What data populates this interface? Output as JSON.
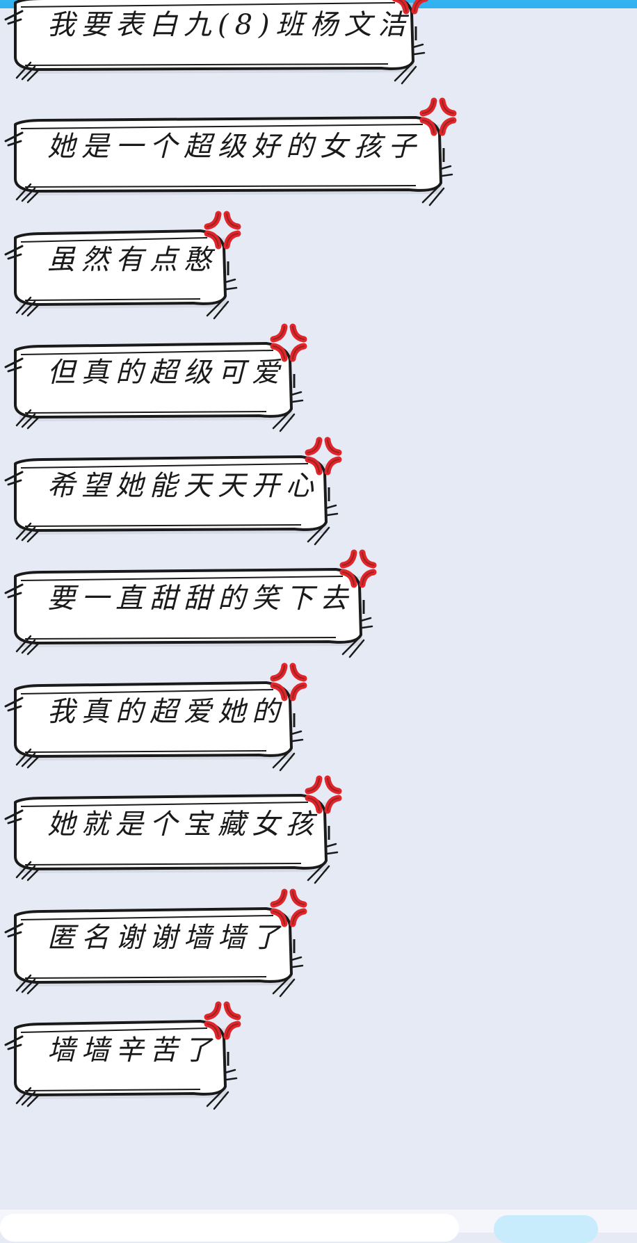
{
  "colors": {
    "background": "#e6eaf4",
    "accent_strip": "#2fb0f0",
    "bubble_fill": "#ffffff",
    "bubble_outline": "#1a1a1a",
    "anger_mark": "#e0262a"
  },
  "messages": [
    {
      "text": "我要表白九(8)班杨文洁"
    },
    {
      "text": "她是一个超级好的女孩子"
    },
    {
      "text": "虽然有点憨"
    },
    {
      "text": "但真的超级可爱"
    },
    {
      "text": "希望她能天天开心"
    },
    {
      "text": "要一直甜甜的笑下去"
    },
    {
      "text": "我真的超爱她的"
    },
    {
      "text": "她就是个宝藏女孩"
    },
    {
      "text": "匿名谢谢墙墙了"
    },
    {
      "text": "墙墙辛苦了"
    }
  ],
  "icons": {
    "bubble_corner": "anger-mark-icon"
  }
}
